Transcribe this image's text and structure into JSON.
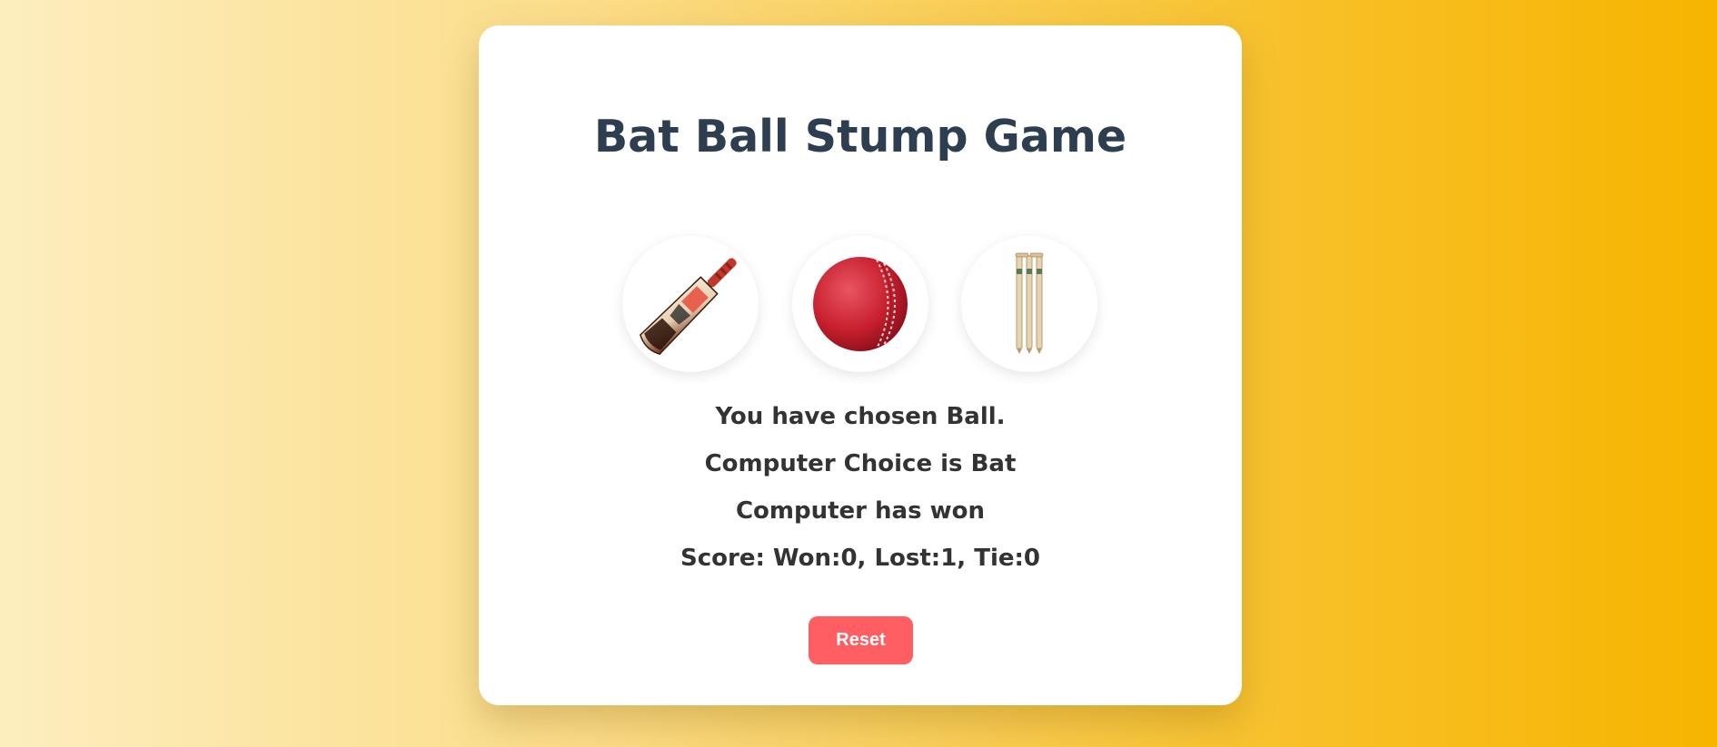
{
  "game": {
    "title": "Bat Ball Stump Game",
    "choices": [
      {
        "name": "Bat",
        "icon": "cricket-bat-icon"
      },
      {
        "name": "Ball",
        "icon": "cricket-ball-icon"
      },
      {
        "name": "Stump",
        "icon": "cricket-stumps-icon"
      }
    ],
    "result": {
      "user_choice_text": "You have chosen Ball.",
      "computer_choice_text": "Computer Choice is Bat",
      "outcome_text": "Computer has won",
      "score_text": "Score: Won:0, Lost:1, Tie:0"
    },
    "reset_label": "Reset"
  },
  "colors": {
    "title": "#2c3e50",
    "text": "#333333",
    "reset_button": "#ff5e62",
    "background_start": "#fdeebf",
    "background_end": "#f7b400"
  }
}
